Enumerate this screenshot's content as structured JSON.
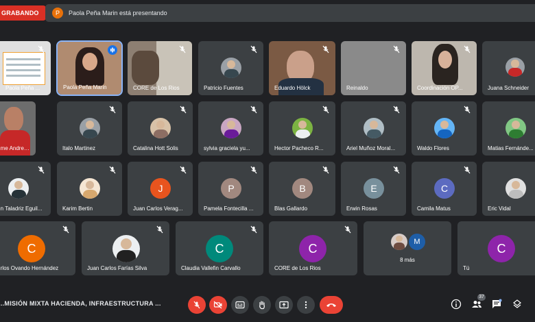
{
  "recording": {
    "label": "GRABANDO"
  },
  "presenting": {
    "avatar_letter": "P",
    "text": "Paola Peña Marin está presentando"
  },
  "row1": [
    {
      "name": "Paola Peña ..."
    },
    {
      "name": "Paola Peña Marin"
    },
    {
      "name": "CORE de Los Rios"
    },
    {
      "name": "Patricio Fuentes"
    },
    {
      "name": "Eduardo Hölck"
    },
    {
      "name": "Reinaldo"
    },
    {
      "name": "Coordinación OP..."
    },
    {
      "name": "Juana Schneider"
    }
  ],
  "row2": [
    {
      "name": "...me Andres Ja..."
    },
    {
      "name": "Italo Martinez"
    },
    {
      "name": "Catalina Hott Solis"
    },
    {
      "name": "sylvia graciela yu..."
    },
    {
      "name": "Hector Pacheco R..."
    },
    {
      "name": "Ariel Muñoz Moral..."
    },
    {
      "name": "Waldo Flores"
    },
    {
      "name": "Matias Fernánde..."
    }
  ],
  "row3": [
    {
      "name": "...n Taladriz Eguil..."
    },
    {
      "name": "Karim Bertin"
    },
    {
      "name": "Juan Carlos Verag...",
      "letter": "J",
      "color": "#e8541e"
    },
    {
      "name": "Pamela Fontecilla ...",
      "letter": "P",
      "color": "#a1887f"
    },
    {
      "name": "Blas Gallardo",
      "letter": "B",
      "color": "#a1887f"
    },
    {
      "name": "Erwin Rosas",
      "letter": "E",
      "color": "#78909c"
    },
    {
      "name": "Camila Matus",
      "letter": "C",
      "color": "#5c6bc0"
    },
    {
      "name": "Eric Vidal"
    }
  ],
  "row4": [
    {
      "name": "...rlos Ovando Hernández",
      "letter": "C",
      "color": "#ef6c00"
    },
    {
      "name": "Juan Carlos Farías Silva"
    },
    {
      "name": "Claudia Vallefin Carvallo",
      "letter": "C",
      "color": "#00897b"
    },
    {
      "name": "CORE de Los Rios",
      "letter": "C",
      "color": "#8e24aa"
    },
    {
      "name": "8 más",
      "letter": "M",
      "color": "#1e5ea8"
    },
    {
      "name": "Tú",
      "letter": "C",
      "color": "#8e24aa"
    }
  ],
  "bottom": {
    "meeting_title": "...MISIÓN MIXTA HACIENDA, INFRAESTRUCTURA ...",
    "participants_count": "37"
  },
  "colors": {
    "background": "#202124",
    "tile": "#3c4043",
    "red": "#ea4335",
    "accent": "#8ab4f8"
  },
  "icons": [
    "mic-off-icon",
    "camera-off-icon",
    "captions-icon",
    "raise-hand-icon",
    "present-icon",
    "more-options-icon",
    "hang-up-icon",
    "info-icon",
    "people-icon",
    "chat-icon",
    "activities-icon"
  ]
}
